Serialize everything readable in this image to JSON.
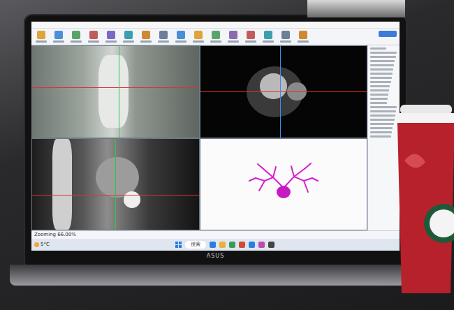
{
  "status_bar": {
    "zoom": "Zooming 66.00%"
  },
  "taskbar": {
    "weather": "5°C",
    "search": "搜索"
  },
  "laptop": {
    "brand": "ASUS"
  }
}
